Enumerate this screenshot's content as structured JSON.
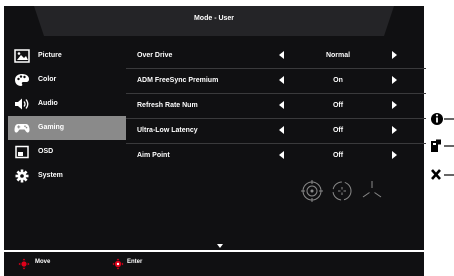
{
  "header": {
    "title": "Mode - User"
  },
  "menu": {
    "items": [
      {
        "label": "Picture",
        "icon": "picture-icon"
      },
      {
        "label": "Color",
        "icon": "palette-icon"
      },
      {
        "label": "Audio",
        "icon": "speaker-icon"
      },
      {
        "label": "Gaming",
        "icon": "gamepad-icon",
        "selected": true
      },
      {
        "label": "OSD",
        "icon": "osd-icon"
      },
      {
        "label": "System",
        "icon": "gear-icon"
      }
    ]
  },
  "settings": {
    "rows": [
      {
        "name": "Over Drive",
        "value": "Normal"
      },
      {
        "name": "ADM FreeSync Premium",
        "value": "On"
      },
      {
        "name": "Refresh Rate Num",
        "value": "Off"
      },
      {
        "name": "Ultra-Low Latency",
        "value": "Off"
      },
      {
        "name": "Aim Point",
        "value": "Off"
      }
    ],
    "aim_point_styles": [
      "circle-crosshair-icon",
      "dotted-circle-icon",
      "tri-line-icon"
    ]
  },
  "hints": {
    "move": "Move",
    "enter": "Enter"
  },
  "hotkeys": [
    "info-icon",
    "input-source-icon",
    "close-icon"
  ],
  "colors": {
    "background": "#101012",
    "selected": "#8a8a8a",
    "accent": "#e0001a"
  }
}
